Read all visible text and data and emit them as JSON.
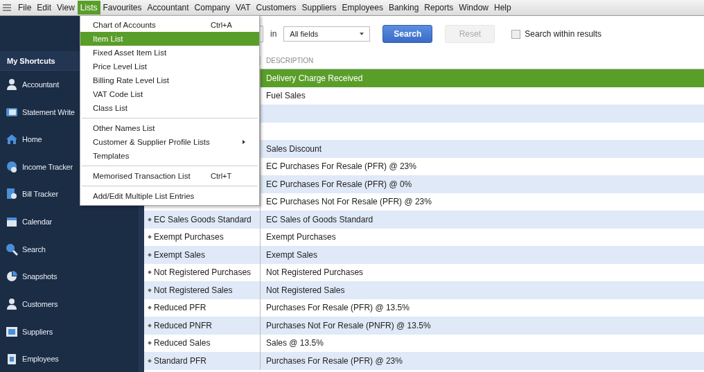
{
  "menubar": [
    {
      "label": "File",
      "selected": false
    },
    {
      "label": "Edit",
      "selected": false
    },
    {
      "label": "View",
      "selected": false
    },
    {
      "label": "Lists",
      "selected": true
    },
    {
      "label": "Favourites",
      "selected": false
    },
    {
      "label": "Accountant",
      "selected": false
    },
    {
      "label": "Company",
      "selected": false
    },
    {
      "label": "VAT",
      "selected": false
    },
    {
      "label": "Customers",
      "selected": false
    },
    {
      "label": "Suppliers",
      "selected": false
    },
    {
      "label": "Employees",
      "selected": false
    },
    {
      "label": "Banking",
      "selected": false
    },
    {
      "label": "Reports",
      "selected": false
    },
    {
      "label": "Window",
      "selected": false
    },
    {
      "label": "Help",
      "selected": false
    }
  ],
  "lists_menu": [
    {
      "kind": "item",
      "label": "Chart of Accounts",
      "shortcut": "Ctrl+A",
      "selected": false
    },
    {
      "kind": "item",
      "label": "Item List",
      "selected": true
    },
    {
      "kind": "item",
      "label": "Fixed Asset Item List",
      "selected": false
    },
    {
      "kind": "item",
      "label": "Price Level List",
      "selected": false
    },
    {
      "kind": "item",
      "label": "Billing Rate Level List",
      "selected": false
    },
    {
      "kind": "item",
      "label": "VAT Code List",
      "selected": false
    },
    {
      "kind": "item",
      "label": "Class List",
      "selected": false
    },
    {
      "kind": "separator"
    },
    {
      "kind": "item",
      "label": "Other Names List",
      "selected": false
    },
    {
      "kind": "submenu",
      "label": "Customer & Supplier Profile Lists",
      "selected": false
    },
    {
      "kind": "item",
      "label": "Templates",
      "selected": false
    },
    {
      "kind": "separator"
    },
    {
      "kind": "item",
      "label": "Memorised Transaction List",
      "shortcut": "Ctrl+T",
      "selected": false
    },
    {
      "kind": "separator"
    },
    {
      "kind": "item",
      "label": "Add/Edit Multiple List Entries",
      "selected": false
    }
  ],
  "sidebar": {
    "title": "My Shortcuts",
    "items": [
      {
        "label": "Accountant"
      },
      {
        "label": "Statement Write"
      },
      {
        "label": "Home"
      },
      {
        "label": "Income Tracker"
      },
      {
        "label": "Bill Tracker"
      },
      {
        "label": "Calendar"
      },
      {
        "label": "Search"
      },
      {
        "label": "Snapshots"
      },
      {
        "label": "Customers"
      },
      {
        "label": "Suppliers"
      },
      {
        "label": "Employees"
      }
    ]
  },
  "search_bar": {
    "in_label": "in",
    "scope": "All fields",
    "search_button": "Search",
    "reset_button": "Reset",
    "reset_disabled": true,
    "within_results": {
      "label": "Search within results",
      "checked": false
    }
  },
  "table": {
    "columns": [
      {
        "label": "DESCRIPTION"
      }
    ],
    "rows": [
      {
        "description": "Delivery Charge Received",
        "selected": true
      },
      {
        "description": "Fuel Sales",
        "selected": false
      },
      {
        "description": "",
        "selected": false
      },
      {
        "description": "",
        "selected": false
      },
      {
        "description": "Sales Discount",
        "selected": false
      },
      {
        "description": "EC Purchases For Resale (PFR) @ 23%",
        "selected": false
      },
      {
        "description": "EC Purchases For Resale (PFR) @ 0%",
        "selected": false
      },
      {
        "description": "EC Purchases Not For Resale (PFR) @ 23%",
        "selected": false
      },
      {
        "name": "EC Sales Goods Standard",
        "description": "EC Sales of Goods Standard",
        "selected": false
      },
      {
        "name": "Exempt Purchases",
        "description": "Exempt Purchases",
        "selected": false
      },
      {
        "name": "Exempt Sales",
        "description": "Exempt Sales",
        "selected": false
      },
      {
        "name": "Not Registered Purchases",
        "description": "Not Registered Purchases",
        "selected": false
      },
      {
        "name": "Not Registered Sales",
        "description": "Not Registered Sales",
        "selected": false
      },
      {
        "name": "Reduced PFR",
        "description": "Purchases For Resale (PFR) @ 13.5%",
        "selected": false
      },
      {
        "name": "Reduced PNFR",
        "description": "Purchases Not For Resale (PNFR) @ 13.5%",
        "selected": false
      },
      {
        "name": "Reduced Sales",
        "description": "Sales @ 13.5%",
        "selected": false
      },
      {
        "name": "Standard PFR",
        "description": "Purchases For Resale (PFR) @ 23%",
        "selected": false
      }
    ]
  }
}
